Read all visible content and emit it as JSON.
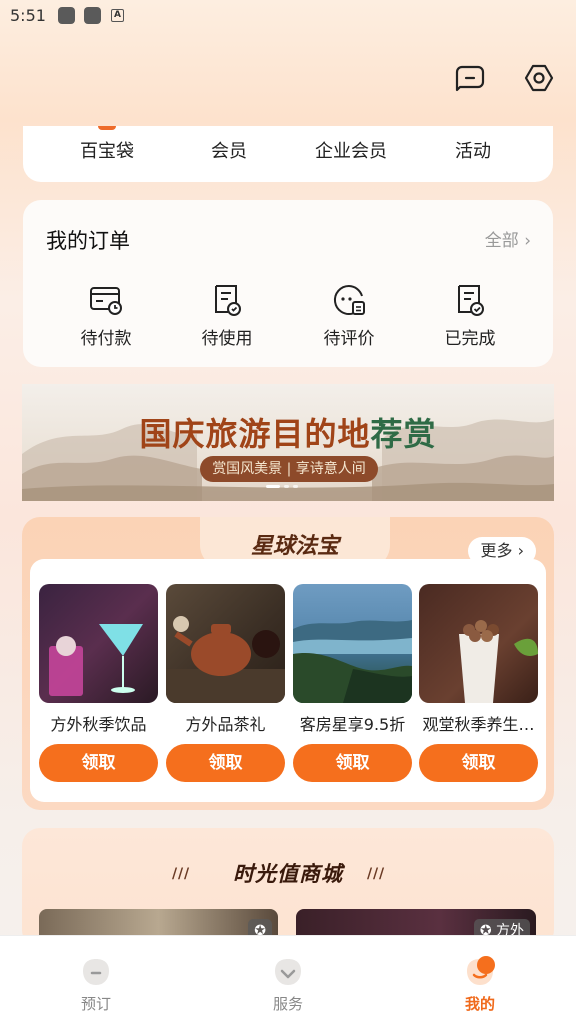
{
  "status_bar": {
    "time": "5:51"
  },
  "top_menu": {
    "items": [
      "百宝袋",
      "会员",
      "企业会员",
      "活动"
    ]
  },
  "orders": {
    "title": "我的订单",
    "all_label": "全部",
    "items": [
      {
        "label": "待付款",
        "icon": "wallet-clock-icon"
      },
      {
        "label": "待使用",
        "icon": "receipt-clock-icon"
      },
      {
        "label": "待评价",
        "icon": "chat-note-icon"
      },
      {
        "label": "已完成",
        "icon": "receipt-check-icon"
      }
    ]
  },
  "banner": {
    "title_part1": "国庆旅游目的地",
    "title_part2": "荐赏",
    "subtitle": "赏国风美景 | 享诗意人间"
  },
  "treasure": {
    "title": "星球法宝",
    "more_label": "更多",
    "products": [
      {
        "name": "方外秋季饮品",
        "button": "领取"
      },
      {
        "name": "方外品茶礼",
        "button": "领取"
      },
      {
        "name": "客房星享9.5折",
        "button": "领取"
      },
      {
        "name": "观堂秋季养生…",
        "button": "领取"
      }
    ]
  },
  "mall": {
    "title": "时光值商城",
    "card_tag": "方外"
  },
  "tabbar": {
    "items": [
      {
        "label": "预订",
        "active": false
      },
      {
        "label": "服务",
        "active": false
      },
      {
        "label": "我的",
        "active": true
      }
    ]
  },
  "colors": {
    "accent": "#f56f1d",
    "brown": "#8d4a2a"
  }
}
